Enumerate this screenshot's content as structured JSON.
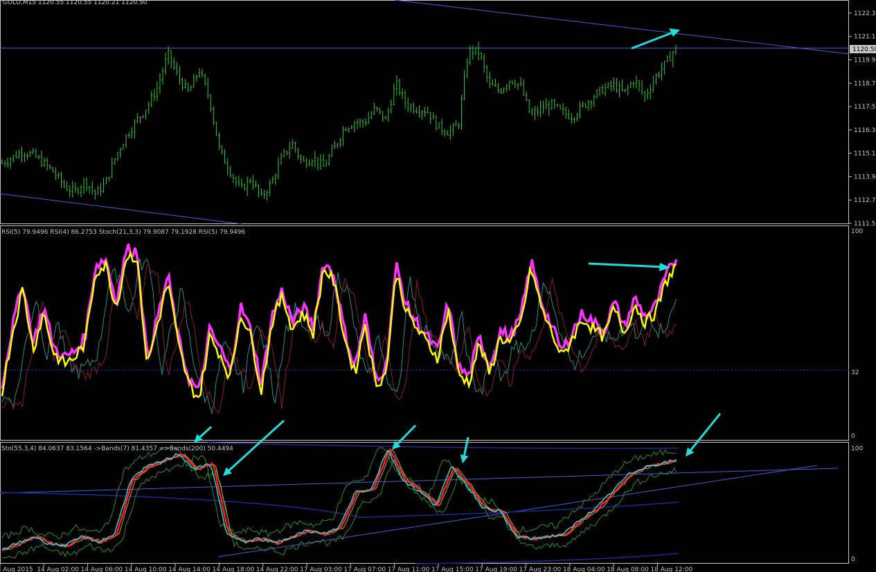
{
  "colors": {
    "background": "#000000",
    "frame": "#c8c8c8",
    "grid": "#1a2a5a",
    "candle": "#33cc33",
    "trendline": "#4a5ee0",
    "arrow": "#22dddd",
    "rsi5": "#ff33ff",
    "rsi4": "#ffff00",
    "stoch_main": "#ff2020",
    "stoch_signal": "#22dddd",
    "bands": "#2f8f2f",
    "level_line": "#2a3aa0"
  },
  "main_panel": {
    "title": "GOLD,M15  1120.55 1120.55 1120.21 1120.50",
    "price_axis": [
      "1122.30",
      "1121.10",
      "1119.90",
      "1118.70",
      "1117.50",
      "1116.30",
      "1115.10",
      "1113.90",
      "1112.70",
      "1111.50"
    ],
    "current_price": "1120.50",
    "chart_data": {
      "type": "candlestick",
      "symbol": "GOLD",
      "timeframe": "M15",
      "ylim": [
        1111.5,
        1122.9
      ],
      "close_path": [
        1114.6,
        1114.9,
        1115.2,
        1115.0,
        1114.6,
        1114.1,
        1113.4,
        1113.1,
        1113.7,
        1113.0,
        1113.6,
        1115.0,
        1116.0,
        1116.8,
        1117.5,
        1118.5,
        1120.2,
        1119.0,
        1118.2,
        1119.4,
        1117.9,
        1115.2,
        1114.2,
        1113.2,
        1113.8,
        1112.8,
        1113.6,
        1114.9,
        1115.6,
        1114.6,
        1114.9,
        1114.4,
        1115.3,
        1116.4,
        1116.7,
        1116.7,
        1117.4,
        1116.8,
        1118.7,
        1117.6,
        1117.4,
        1117.3,
        1116.5,
        1116.2,
        1116.5,
        1120.4,
        1120.3,
        1118.6,
        1118.3,
        1118.9,
        1118.6,
        1117.0,
        1117.4,
        1117.6,
        1117.2,
        1117.0,
        1117.5,
        1118.0,
        1118.4,
        1118.6,
        1118.2,
        1118.9,
        1118.0,
        1119.0,
        1119.7,
        1120.5
      ]
    },
    "arrow_up": true
  },
  "rsi_panel": {
    "title": "RSI(5) 79.9496  RSI(4) 86.2753  Stoch(21,3,3) 79.9087 79.1928  RSI(5) 79.9496",
    "levels": [
      "100",
      "32",
      "0"
    ],
    "chart_data": {
      "type": "line",
      "ylim": [
        0,
        100
      ],
      "level": 32,
      "rsi_path": [
        22,
        50,
        72,
        42,
        60,
        40,
        35,
        38,
        45,
        80,
        83,
        62,
        88,
        87,
        34,
        55,
        75,
        44,
        25,
        18,
        48,
        40,
        28,
        60,
        48,
        22,
        55,
        68,
        52,
        60,
        50,
        82,
        75,
        48,
        30,
        55,
        25,
        30,
        80,
        60,
        52,
        45,
        38,
        62,
        30,
        26,
        45,
        30,
        48,
        45,
        55,
        82,
        62,
        50,
        38,
        48,
        57,
        52,
        48,
        62,
        50,
        64,
        55,
        60,
        75,
        83
      ],
      "series": [
        {
          "name": "RSI(5)",
          "last": 79.9496
        },
        {
          "name": "RSI(4)",
          "last": 86.2753
        },
        {
          "name": "Stoch(21,3,3)",
          "last": 79.9087
        }
      ]
    }
  },
  "stoch_panel": {
    "title": "Sto(55,3,4) 84.0637 83.1564  ->Bands(7) 81.4357  =>Bands(200) 50.4494",
    "levels": [
      "100",
      "0"
    ],
    "chart_data": {
      "type": "line",
      "ylim": [
        0,
        100
      ],
      "stoch_path": [
        8,
        14,
        20,
        13,
        12,
        20,
        15,
        22,
        70,
        82,
        87,
        94,
        80,
        85,
        22,
        15,
        18,
        14,
        20,
        25,
        22,
        28,
        60,
        62,
        98,
        70,
        60,
        48,
        82,
        65,
        45,
        43,
        20,
        18,
        20,
        22,
        35,
        45,
        60,
        75,
        82,
        85,
        88
      ],
      "series": [
        {
          "name": "Sto(55,3,4)",
          "last": 84.0637
        },
        {
          "name": "Bands(7)",
          "last": 81.4357
        },
        {
          "name": "Bands(200)",
          "last": 50.4494
        }
      ]
    }
  },
  "time_axis": [
    "13 Aug 2015",
    "14 Aug 02:00",
    "14 Aug 06:00",
    "14 Aug 10:00",
    "14 Aug 14:00",
    "14 Aug 18:00",
    "14 Aug 22:00",
    "17 Aug 03:00",
    "17 Aug 07:00",
    "17 Aug 11:00",
    "17 Aug 15:00",
    "17 Aug 19:00",
    "17 Aug 23:00",
    "18 Aug 04:00",
    "18 Aug 08:00",
    "18 Aug 12:00"
  ]
}
